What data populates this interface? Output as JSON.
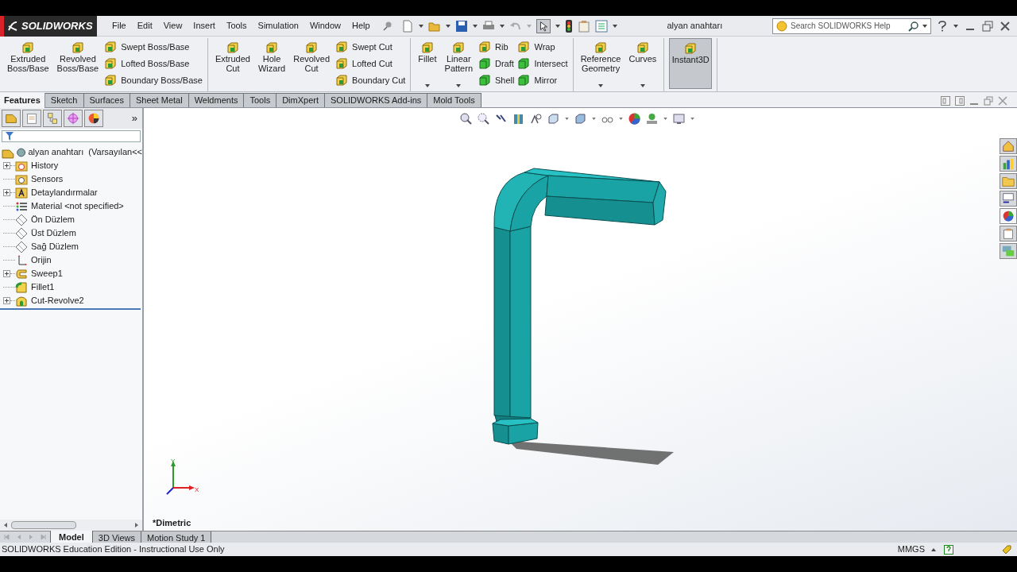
{
  "app": {
    "logo": "SOLIDWORKS",
    "document_title": "alyan anahtarı",
    "search": {
      "placeholder": "Search SOLIDWORKS Help"
    }
  },
  "menu": [
    "File",
    "Edit",
    "View",
    "Insert",
    "Tools",
    "Simulation",
    "Window",
    "Help"
  ],
  "ribbon": {
    "groups": [
      {
        "columns": [
          {
            "kind": "large",
            "label": "Extruded Boss/Base"
          },
          {
            "kind": "large",
            "label": "Revolved Boss/Base"
          },
          {
            "kind": "stack",
            "items": [
              "Swept Boss/Base",
              "Lofted Boss/Base",
              "Boundary Boss/Base"
            ]
          }
        ]
      },
      {
        "columns": [
          {
            "kind": "large",
            "label": "Extruded Cut"
          },
          {
            "kind": "large",
            "label": "Hole Wizard"
          },
          {
            "kind": "large",
            "label": "Revolved Cut"
          },
          {
            "kind": "stack",
            "items": [
              "Swept Cut",
              "Lofted Cut",
              "Boundary Cut"
            ]
          }
        ]
      },
      {
        "columns": [
          {
            "kind": "large",
            "label": "Fillet",
            "dropdown": true
          },
          {
            "kind": "large",
            "label": "Linear Pattern",
            "dropdown": true
          },
          {
            "kind": "stack",
            "items": [
              "Rib",
              "Draft",
              "Shell"
            ]
          },
          {
            "kind": "stack",
            "items": [
              "Wrap",
              "Intersect",
              "Mirror"
            ]
          }
        ]
      },
      {
        "columns": [
          {
            "kind": "large",
            "label": "Reference Geometry",
            "dropdown": true
          },
          {
            "kind": "large",
            "label": "Curves",
            "dropdown": true
          }
        ]
      },
      {
        "columns": [
          {
            "kind": "large",
            "label": "Instant3D",
            "dropdown": false,
            "selected": true
          }
        ]
      }
    ]
  },
  "command_tabs": [
    {
      "label": "Features",
      "selected": true
    },
    {
      "label": "Sketch",
      "selected": false
    },
    {
      "label": "Surfaces",
      "selected": false
    },
    {
      "label": "Sheet Metal",
      "selected": false
    },
    {
      "label": "Weldments",
      "selected": false
    },
    {
      "label": "Tools",
      "selected": false
    },
    {
      "label": "DimXpert",
      "selected": false
    },
    {
      "label": "SOLIDWORKS Add-ins",
      "selected": false
    },
    {
      "label": "Mold Tools",
      "selected": false
    }
  ],
  "feature_tree": {
    "more": "»",
    "root": "alyan anahtarı  (Varsayılan<<",
    "children": [
      {
        "label": "History",
        "expander": true
      },
      {
        "label": "Sensors",
        "expander": false
      },
      {
        "label": "Detaylandırmalar",
        "expander": true
      },
      {
        "label": "Material <not specified>",
        "expander": false
      },
      {
        "label": "Ön Düzlem",
        "expander": false
      },
      {
        "label": "Üst Düzlem",
        "expander": false
      },
      {
        "label": "Sağ Düzlem",
        "expander": false
      },
      {
        "label": "Orijin",
        "expander": false
      },
      {
        "label": "Sweep1",
        "expander": true
      },
      {
        "label": "Fillet1",
        "expander": false
      },
      {
        "label": "Cut-Revolve2",
        "expander": true
      }
    ]
  },
  "viewport": {
    "view_name": "*Dimetric",
    "triad": {
      "x": "X",
      "y": "Y"
    }
  },
  "bottom_tabs": [
    {
      "label": "Model",
      "selected": true
    },
    {
      "label": "3D Views",
      "selected": false
    },
    {
      "label": "Motion Study 1",
      "selected": false
    }
  ],
  "status_bar": {
    "text": "SOLIDWORKS Education Edition - Instructional Use Only",
    "units": "MMGS"
  }
}
